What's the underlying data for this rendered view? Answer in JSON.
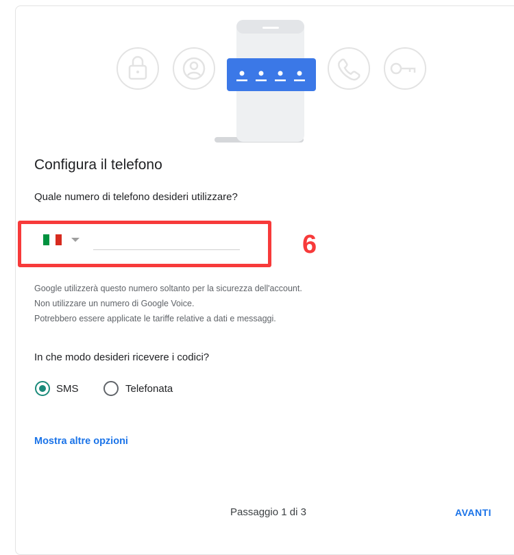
{
  "illustration": {
    "pin_dots": 4,
    "icons": [
      "lock-icon",
      "account-icon",
      "phone-call-icon",
      "key-icon"
    ],
    "colors": {
      "pin_bar": "#3b78e7",
      "phone_body": "#e8eaed",
      "icon_outline": "#e0e0e0"
    }
  },
  "page": {
    "title": "Configura il telefono",
    "question": "Quale numero di telefono desideri utilizzare?"
  },
  "phone": {
    "country": "IT",
    "flag_colors": [
      "#00923f",
      "#ffffff",
      "#d72b1f"
    ],
    "value": "",
    "placeholder": ""
  },
  "annotation": {
    "number": "6",
    "color": "#f73a3a"
  },
  "notes": [
    "Google utilizzerà questo numero soltanto per la sicurezza dell'account.",
    "Non utilizzare un numero di Google Voice.",
    "Potrebbero essere applicate le tariffe relative a dati e messaggi."
  ],
  "codes": {
    "question": "In che modo desideri ricevere i codici?",
    "options": [
      {
        "label": "SMS",
        "selected": true
      },
      {
        "label": "Telefonata",
        "selected": false
      }
    ]
  },
  "more_options": "Mostra altre opzioni",
  "footer": {
    "step": "Passaggio 1 di 3",
    "next": "AVANTI"
  }
}
